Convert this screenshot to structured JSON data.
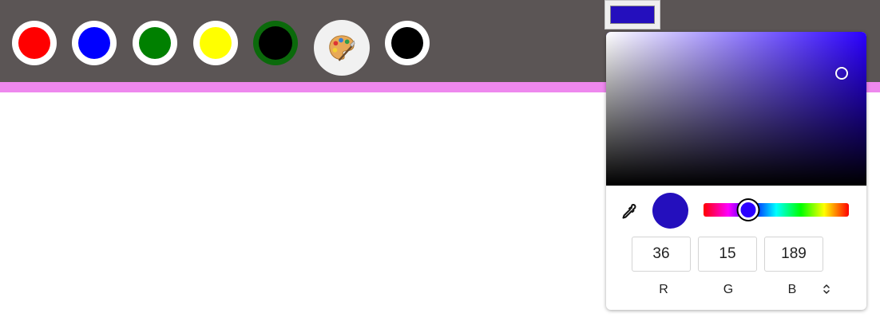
{
  "toolbar": {
    "background": "#5b5555",
    "accent_strip_color": "#ee88ee",
    "swatches": [
      {
        "name": "swatch-red",
        "color": "#ff0000"
      },
      {
        "name": "swatch-blue",
        "color": "#0000ff"
      },
      {
        "name": "swatch-green",
        "color": "#008000"
      },
      {
        "name": "swatch-yellow",
        "color": "#ffff00"
      },
      {
        "name": "swatch-black-selected",
        "color": "#000000",
        "selected": true
      },
      {
        "name": "swatch-black",
        "color": "#000000"
      }
    ],
    "palette_icon": "artist-palette-icon"
  },
  "color_input": {
    "current_color": "#240fbd"
  },
  "picker": {
    "hue_color": "#2b00ff",
    "hue_fraction": 0.31,
    "preview_color": "#240fbd",
    "eyedropper_icon": "eyedropper-icon",
    "mode_toggle_icon": "up-down-chevron-icon",
    "rgb": {
      "r": "36",
      "g": "15",
      "b": "189",
      "r_label": "R",
      "g_label": "G",
      "b_label": "B"
    }
  }
}
